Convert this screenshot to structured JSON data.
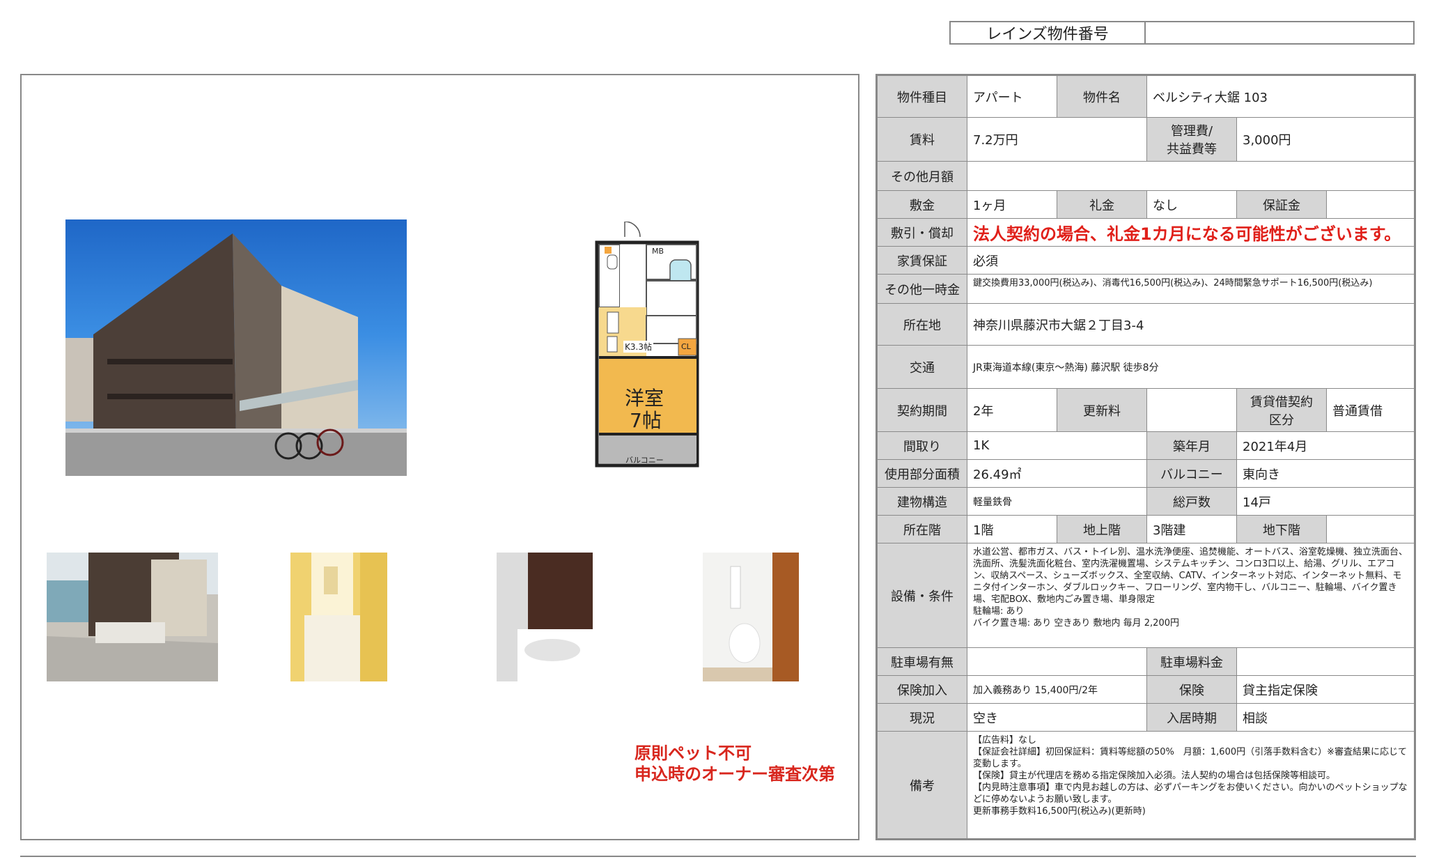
{
  "header": {
    "reins_label": "レインズ物件番号",
    "reins_value": ""
  },
  "notes": {
    "pet_line1": "原則ペット不可",
    "pet_line2": "申込時のオーナー審査次第"
  },
  "floorplan": {
    "mb": "MB",
    "kitchen": "K3.3帖",
    "cl": "CL",
    "room_name": "洋室",
    "room_size": "7帖",
    "balcony": "バルコニー"
  },
  "spec": {
    "type_label": "物件種目",
    "type": "アパート",
    "name_label": "物件名",
    "name": "ベルシティ大鋸 103",
    "rent_label": "賃料",
    "rent": "7.2万円",
    "mgmt_label_1": "管理費/",
    "mgmt_label_2": "共益費等",
    "mgmt": "3,000円",
    "other_monthly_label": "その他月額",
    "other_monthly": "",
    "deposit_label": "敷金",
    "deposit": "1ヶ月",
    "key_money_label": "礼金",
    "key_money": "なし",
    "guarantee_money_label": "保証金",
    "guarantee_money": "",
    "shikibiki_label": "敷引・償却",
    "shikibiki": "法人契約の場合、礼金1カ月になる可能性がございます。",
    "rent_guarantee_label": "家賃保証",
    "rent_guarantee": "必須",
    "other_onetime_label": "その他一時金",
    "other_onetime": "鍵交換費用33,000円(税込み)、消毒代16,500円(税込み)、24時間緊急サポート16,500円(税込み)",
    "address_label": "所在地",
    "address": "神奈川県藤沢市大鋸２丁目3-4",
    "transport_label": "交通",
    "transport": "JR東海道本線(東京～熱海) 藤沢駅 徒歩8分",
    "term_label": "契約期間",
    "term": "2年",
    "renewal_label": "更新料",
    "renewal": "",
    "lease_type_label_1": "賃貸借契約",
    "lease_type_label_2": "区分",
    "lease_type": "普通賃借",
    "layout_label": "間取り",
    "layout": "1K",
    "built_label": "築年月",
    "built": "2021年4月",
    "area_label": "使用部分面積",
    "area": "26.49㎡",
    "balcony_label": "バルコニー",
    "balcony": "東向き",
    "structure_label": "建物構造",
    "structure": "軽量鉄骨",
    "units_label": "総戸数",
    "units": "14戸",
    "floor_label": "所在階",
    "floor": "1階",
    "above_label": "地上階",
    "above": "3階建",
    "below_label": "地下階",
    "below": "",
    "facilities_label": "設備・条件",
    "facilities": "水道公営、都市ガス、バス・トイレ別、温水洗浄便座、追焚機能、オートバス、浴室乾燥機、独立洗面台、洗面所、洗髪洗面化粧台、室内洗濯機置場、システムキッチン、コンロ3口以上、給湯、グリル、エアコン、収納スペース、シューズボックス、全室収納、CATV、インターネット対応、インターネット無料、モニタ付インターホン、ダブルロックキー、フローリング、室内物干し、バルコニー、駐輪場、バイク置き場、宅配BOX、敷地内ごみ置き場、単身限定",
    "facilities_bike": "駐輪場: あり",
    "facilities_moto": "バイク置き場: あり 空きあり 敷地内 毎月 2,200円",
    "parking_label": "駐車場有無",
    "parking": "",
    "parking_fee_label": "駐車場料金",
    "parking_fee": "",
    "insurance_label": "保険加入",
    "insurance": "加入義務あり 15,400円/2年",
    "insurance_type_label": "保険",
    "insurance_type": "貸主指定保険",
    "status_label": "現況",
    "status": "空き",
    "move_in_label": "入居時期",
    "move_in": "相談",
    "remarks_label": "備考",
    "remarks_1": "【広告料】なし",
    "remarks_2": "【保証会社詳細】初回保証料：賃料等総額の50%　月額：1,600円（引落手数料含む）※審査結果に応じて変動します。",
    "remarks_3": "【保険】貸主が代理店を務める指定保険加入必須。法人契約の場合は包括保険等相談可。",
    "remarks_4": "【内見時注意事項】車で内見お越しの方は、必ずパーキングをお使いください。向かいのペットショップなどに停めないようお願い致します。",
    "remarks_5": "更新事務手数料16,500円(税込み)(更新時)"
  }
}
